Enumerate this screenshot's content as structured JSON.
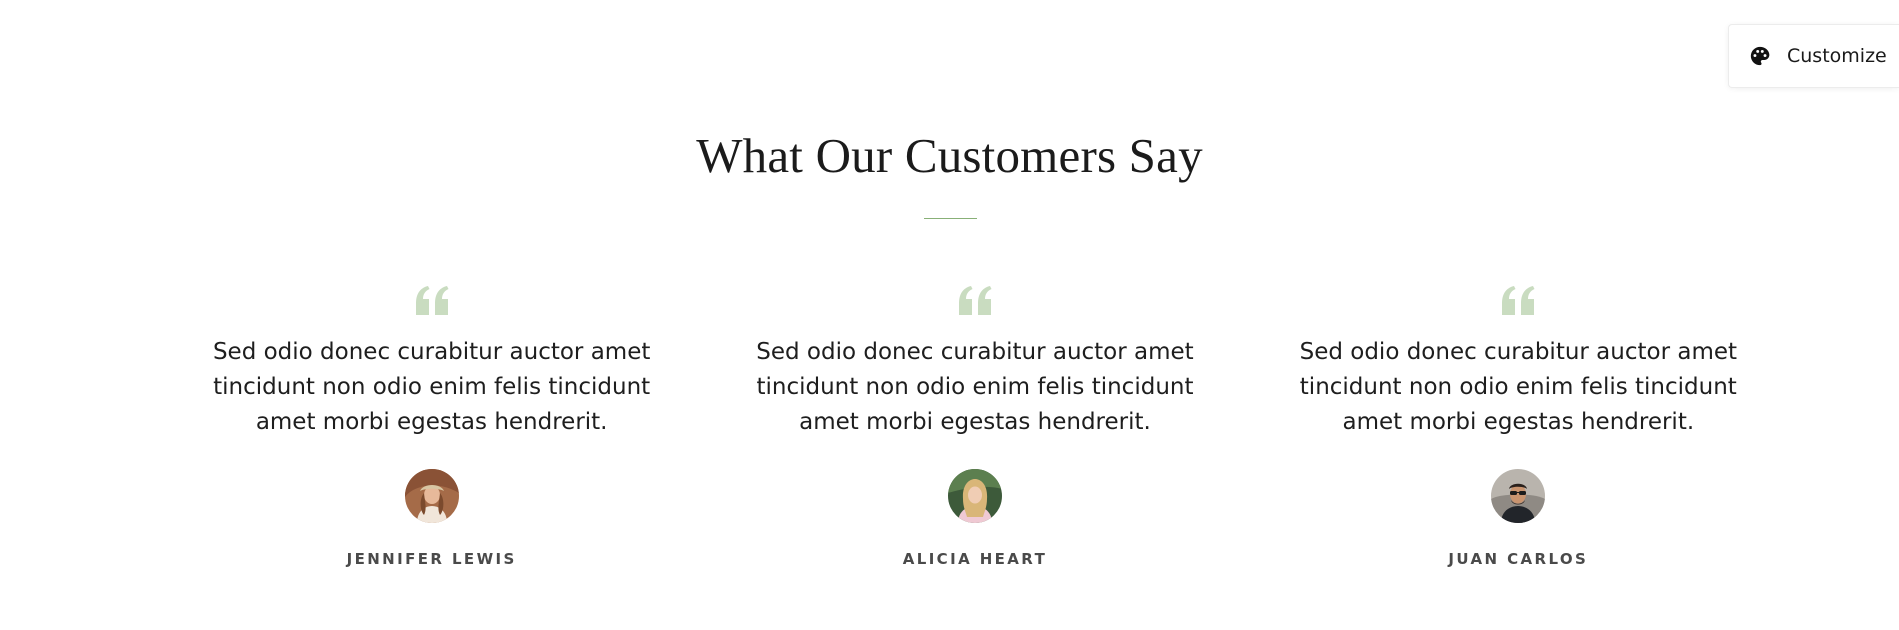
{
  "customize": {
    "label": "Customize",
    "icon": "palette-icon"
  },
  "section": {
    "title": "What Our Customers Say",
    "accent_color": "#88b077"
  },
  "testimonials": [
    {
      "quote": "Sed odio donec curabitur auctor amet tincidunt non odio enim felis tincidunt amet morbi egestas hendrerit.",
      "name": "JENNIFER LEWIS",
      "avatar": "avatar-jennifer-lewis"
    },
    {
      "quote": "Sed odio donec curabitur auctor amet tincidunt non odio enim felis tincidunt amet morbi egestas hendrerit.",
      "name": "ALICIA HEART",
      "avatar": "avatar-alicia-heart"
    },
    {
      "quote": "Sed odio donec curabitur auctor amet tincidunt non odio enim felis tincidunt amet morbi egestas hendrerit.",
      "name": "JUAN CARLOS",
      "avatar": "avatar-juan-carlos"
    }
  ],
  "colors": {
    "quote_icon": "#c9dcc0",
    "heading": "#1b1b1b",
    "author": "#4a4a4a"
  }
}
